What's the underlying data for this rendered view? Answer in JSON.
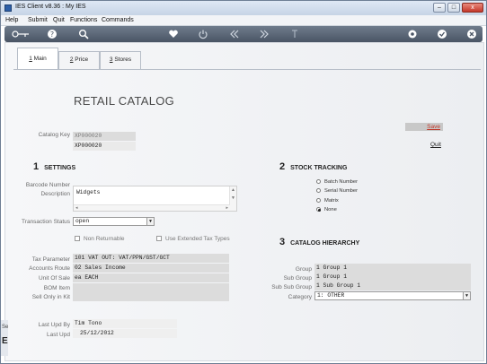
{
  "window": {
    "title": "IES Client v8.36 : My IES",
    "minimize": "–",
    "maximize": "□",
    "close": "x"
  },
  "menu": [
    "Help",
    "Submit",
    "Quit",
    "Functions",
    "Commands"
  ],
  "toolbar_icons": [
    "key-icon",
    "help-icon",
    "search-icon",
    "heart-icon",
    "power-icon",
    "rewind-icon",
    "fast-forward-icon",
    "upload-icon",
    "settings-icon",
    "check-icon",
    "close-icon"
  ],
  "tabs": [
    {
      "key": "1",
      "label": " Main"
    },
    {
      "key": "2",
      "label": " Price"
    },
    {
      "key": "3",
      "label": " Stores"
    }
  ],
  "heading": "RETAIL CATALOG",
  "save_label": "Save",
  "quit_label": "Quit",
  "catalog_key": {
    "label": "Catalog Key",
    "value1": "XP000020",
    "value2": "XP000020"
  },
  "settings": {
    "num": "1",
    "title": "SETTINGS",
    "barcode_label": "Barcode Number",
    "description_label": "Description",
    "description_value": "Widgets",
    "transaction_status_label": "Transaction Status",
    "transaction_status_value": "open",
    "non_returnable_label": "Non Returnable",
    "extended_tax_label": "Use Extended Tax Types",
    "tax_parameter_label": "Tax Parameter",
    "tax_parameter_value": "101 VAT OUT: VAT/PPN/GST/GCT",
    "accounts_route_label": "Accounts Route",
    "accounts_route_value": "02 Sales Income",
    "unit_of_sale_label": "Unit Of Sale",
    "unit_of_sale_value": "ea EACH",
    "bom_item_label": "BOM Item",
    "sell_only_label": "Sell Only in Kit",
    "last_upd_by_label": "Last Upd By",
    "last_upd_by_value": "Tim Tono",
    "last_upd_label": "Last Upd",
    "last_upd_value": "25/12/2012"
  },
  "stock_tracking": {
    "num": "2",
    "title": "STOCK TRACKING",
    "options": [
      "Batch Number",
      "Serial Number",
      "Matrix",
      "None"
    ],
    "selected": "None"
  },
  "catalog_hierarchy": {
    "num": "3",
    "title": "CATALOG HIERARCHY",
    "group_label": "Group",
    "group_value": "1 Group 1",
    "sub_group_label": "Sub Group",
    "sub_group_value": "1 Group 1",
    "sub_sub_group_label": "Sub Sub Group",
    "sub_sub_group_value": "1 Sub Group 1",
    "category_label": "Category",
    "category_value": "1: OTHER"
  },
  "side_strip": {
    "text": "Se",
    "letter": "E"
  },
  "colors": {
    "toolbar": "#5b6778",
    "save_text": "#c0392b",
    "field_bg": "#dcdcdc"
  }
}
